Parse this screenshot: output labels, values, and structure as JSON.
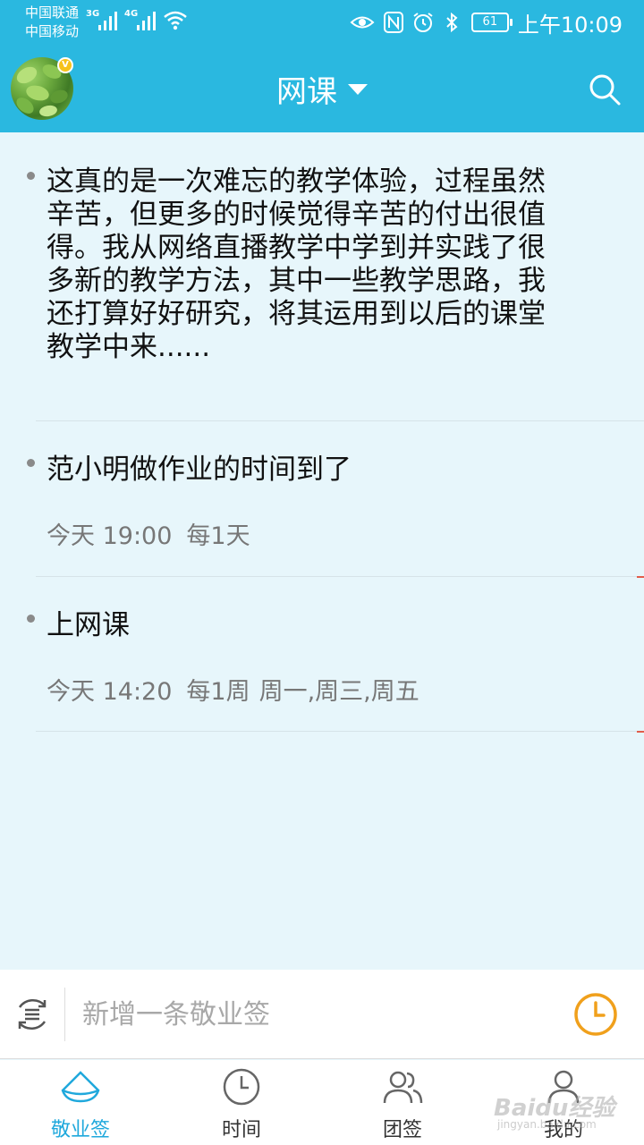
{
  "status_bar": {
    "carrier_1": "中国联通",
    "carrier_2": "中国移动",
    "network_1": "3G",
    "network_2": "4G",
    "battery": "61",
    "time": "上午10:09"
  },
  "header": {
    "title": "网课",
    "avatar_badge": "V"
  },
  "notes": [
    {
      "text": "这真的是一次难忘的教学体验，过程虽然辛苦，但更多的时候觉得辛苦的付出很值得。我从网络直播教学中学到并实践了很多新的教学方法，其中一些教学思路，我还打算好好研究，将其运用到以后的课堂教学中来......"
    },
    {
      "text": "范小明做作业的时间到了",
      "time": "今天 19:00",
      "repeat": "每1天",
      "days": ""
    },
    {
      "text": "上网课",
      "time": "今天 14:20",
      "repeat": "每1周",
      "days": "周一,周三,周五"
    }
  ],
  "input_bar": {
    "placeholder": "新增一条敬业签"
  },
  "tabs": [
    {
      "label": "敬业签",
      "icon": "note-boat-icon",
      "active": true
    },
    {
      "label": "时间",
      "icon": "clock-icon",
      "active": false
    },
    {
      "label": "团签",
      "icon": "group-icon",
      "active": false
    },
    {
      "label": "我的",
      "icon": "person-icon",
      "active": false
    }
  ],
  "watermark": {
    "brand": "Baidu经验",
    "url": "jingyan.baidu.com"
  },
  "colors": {
    "header_bg": "#2ab8e0",
    "content_bg": "#e7f6fb",
    "active_tab": "#1fa8dc",
    "alarm_accent": "#f0a01c"
  }
}
